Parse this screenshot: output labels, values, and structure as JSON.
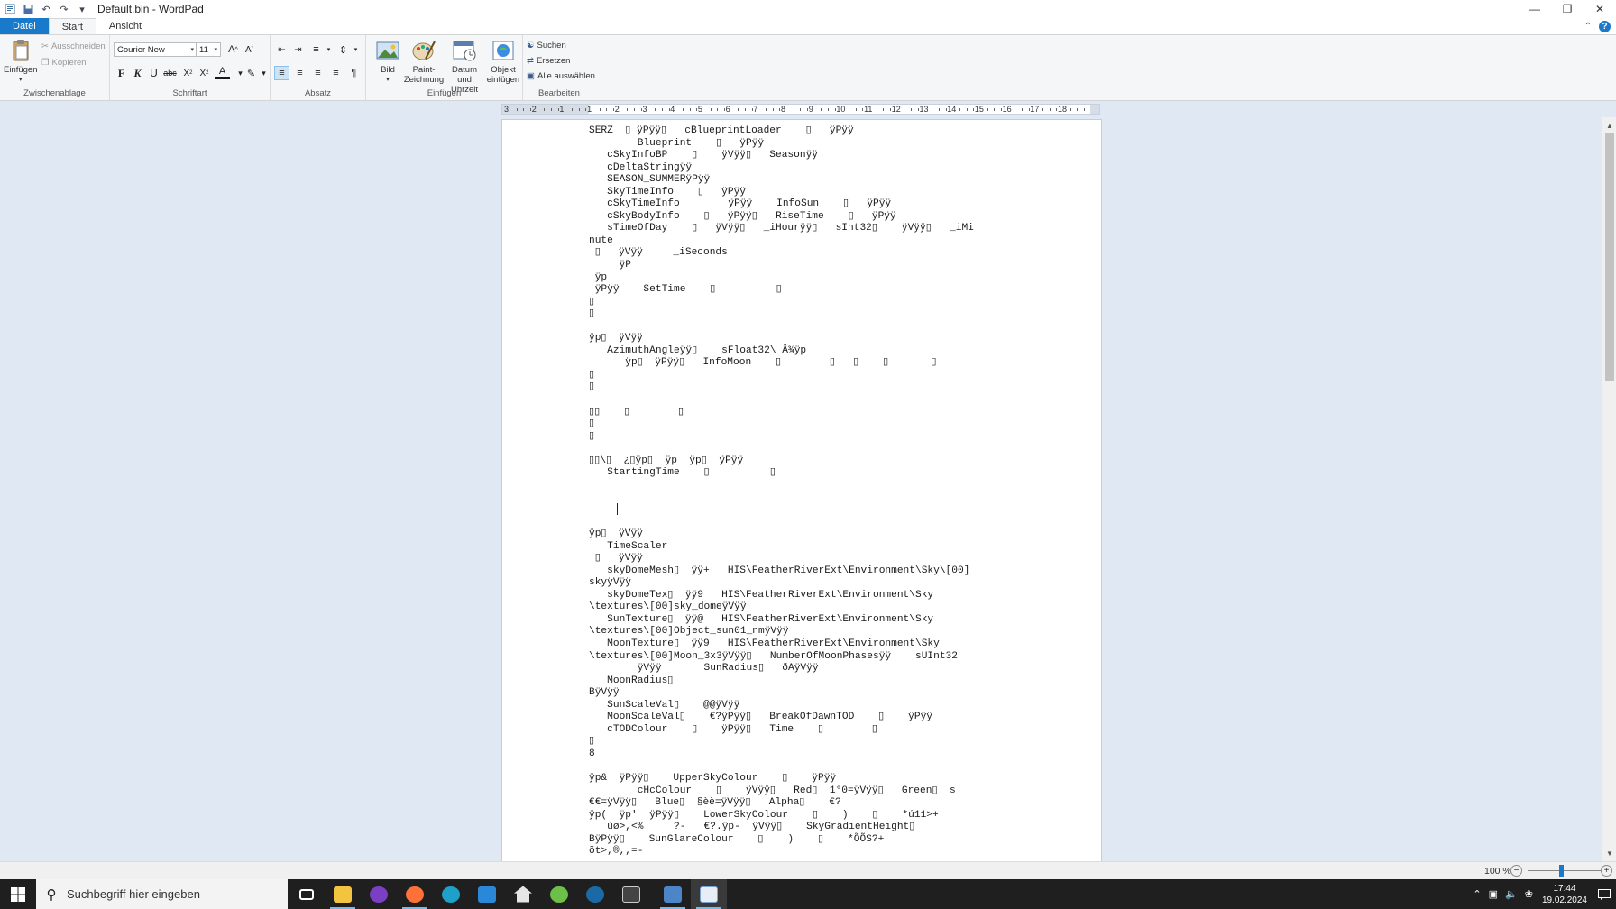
{
  "window": {
    "title": "Default.bin - WordPad",
    "minimize_icon": "minimize-icon",
    "restore_icon": "restore-icon",
    "close_icon": "close-icon"
  },
  "quick_access": {
    "items": [
      "app-icon",
      "save-icon",
      "undo-icon",
      "redo-icon",
      "customize-dropdown-icon"
    ]
  },
  "tabs": {
    "file": "Datei",
    "start": "Start",
    "view": "Ansicht"
  },
  "ribbon": {
    "clipboard": {
      "label": "Zwischenablage",
      "paste": "Einfügen",
      "cut": "Ausschneiden",
      "copy": "Kopieren"
    },
    "font": {
      "label": "Schriftart",
      "family": "Courier New",
      "size": "11",
      "bold": "F",
      "italic": "K",
      "underline": "U"
    },
    "paragraph": {
      "label": "Absatz"
    },
    "insert": {
      "label": "Einfügen",
      "picture": "Bild",
      "paint_line1": "Paint-",
      "paint_line2": "Zeichnung",
      "datetime_line1": "Datum und",
      "datetime_line2": "Uhrzeit",
      "object_line1": "Objekt",
      "object_line2": "einfügen"
    },
    "editing": {
      "label": "Bearbeiten",
      "find": "Suchen",
      "replace": "Ersetzen",
      "select_all": "Alle auswählen"
    }
  },
  "ruler": {
    "labels": [
      "3",
      "2",
      "1",
      "1",
      "2",
      "3",
      "4",
      "5",
      "6",
      "7",
      "8",
      "9",
      "10",
      "11",
      "12",
      "13",
      "14",
      "15",
      "16",
      "17",
      "18"
    ]
  },
  "document": {
    "lines": [
      "SERZ  ▯ ÿPÿÿ▯   cBlueprintLoader    ▯   ÿPÿÿ",
      "        Blueprint    ▯   ÿPÿÿ",
      "   cSkyInfoBP    ▯    ÿVÿÿ▯   Seasonÿÿ",
      "   cDeltaStringÿÿ",
      "   SEASON_SUMMERÿPÿÿ",
      "   SkyTimeInfo    ▯   ÿPÿÿ",
      "   cSkyTimeInfo        ÿPÿÿ    InfoSun    ▯   ÿPÿÿ",
      "   cSkyBodyInfo    ▯   ÿPÿÿ▯   RiseTime    ▯   ÿPÿÿ",
      "   sTimeOfDay    ▯   ÿVÿÿ▯   _iHourÿÿ▯   sInt32▯    ÿVÿÿ▯   _iMi",
      "nute",
      " ▯   ÿVÿÿ     _iSeconds",
      "     ÿP",
      " ÿp",
      " ÿPÿÿ    SetTime    ▯          ▯",
      "▯",
      "▯",
      "",
      "ÿp▯  ÿVÿÿ",
      "   AzimuthAngleÿÿ▯    sFloat32\\ Â¾ÿp",
      "      ÿp▯  ÿPÿÿ▯   InfoMoon    ▯        ▯   ▯    ▯       ▯",
      "▯",
      "▯",
      "",
      "▯▯    ▯        ▯",
      "▯",
      "▯",
      "",
      "▯▯\\▯  ¿▯ÿp▯  ÿp  ÿp▯  ÿPÿÿ",
      "   StartingTime    ▯          ▯",
      "",
      "",
      "",
      "",
      "ÿp▯  ÿVÿÿ",
      "   TimeScaler",
      " ▯   ÿVÿÿ",
      "   skyDomeMesh▯  ÿÿ+   HIS\\FeatherRiverExt\\Environment\\Sky\\[00]",
      "skyÿVÿÿ",
      "   skyDomeTex▯  ÿÿ9   HIS\\FeatherRiverExt\\Environment\\Sky",
      "\\textures\\[00]sky_domeÿVÿÿ",
      "   SunTexture▯  ÿÿ@   HIS\\FeatherRiverExt\\Environment\\Sky",
      "\\textures\\[00]Object_sun01_nmÿVÿÿ",
      "   MoonTexture▯  ÿÿ9   HIS\\FeatherRiverExt\\Environment\\Sky",
      "\\textures\\[00]Moon_3x3ÿVÿÿ▯   NumberOfMoonPhasesÿÿ    sUInt32",
      "        ÿVÿÿ       SunRadius▯   ðAÿVÿÿ",
      "   MoonRadius▯",
      "BÿVÿÿ",
      "   SunScaleVal▯    @@ÿVÿÿ",
      "   MoonScaleVal▯    €?ÿPÿÿ▯   BreakOfDawnTOD    ▯    ÿPÿÿ",
      "   cTODColour    ▯    ÿPÿÿ▯   Time    ▯        ▯",
      "▯",
      "8",
      "",
      "ÿp&  ÿPÿÿ▯    UpperSkyColour    ▯    ÿPÿÿ",
      "        cHcColour    ▯    ÿVÿÿ▯   Red▯  1°0=ÿVÿÿ▯   Green▯  s",
      "€€=ÿVÿÿ▯   Blue▯  §èè=ÿVÿÿ▯   Alpha▯    €?",
      "ÿp(  ÿp'  ÿPÿÿ▯    LowerSkyColour    ▯    )    ▯    *ú11>+",
      "   ùø>,<%     ?-   €?.ÿp-  ÿVÿÿ▯    SkyGradientHeight▯",
      "BÿPÿÿ▯    SunGlareColour    ▯    )    ▯    *ÕÕS?+",
      "õt>,®,,=-"
    ]
  },
  "status": {
    "zoom": "100 %",
    "zoom_level_percent": 100
  },
  "taskbar": {
    "search_placeholder": "Suchbegriff hier eingeben",
    "time": "17:44",
    "date": "19.02.2024",
    "apps": [
      "task-view-icon",
      "file-explorer-icon",
      "app-icon-2",
      "firefox-icon",
      "edge-icon",
      "mail-icon",
      "home-icon",
      "app-green-icon",
      "steam-icon",
      "app-tb-icon",
      "app-blue-icon",
      "wordpad-icon"
    ]
  }
}
